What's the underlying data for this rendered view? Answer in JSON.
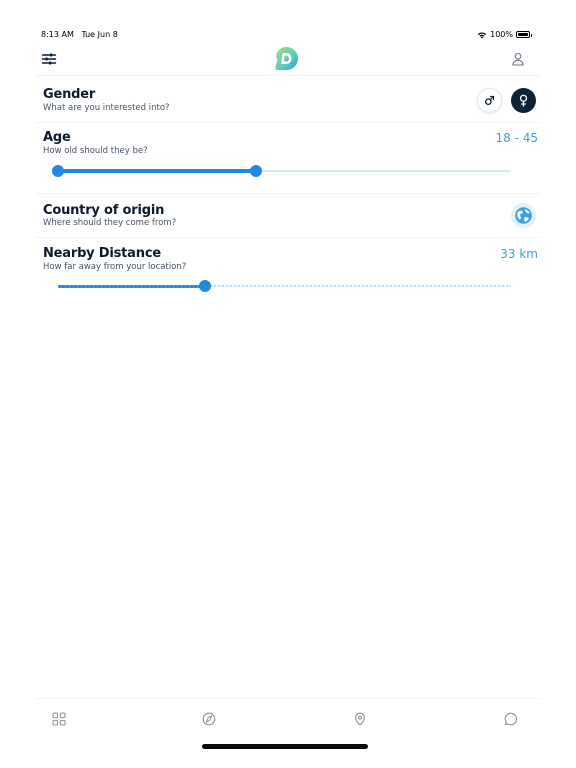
{
  "status_bar": {
    "time": "8:13 AM",
    "date": "Tue Jun 8",
    "battery": "100%"
  },
  "nav": {
    "filter_icon": "sliders-icon",
    "logo_icon": "d-logo-icon",
    "profile_icon": "user-icon"
  },
  "filters": {
    "gender": {
      "title": "Gender",
      "subtitle": "What are you interested into?",
      "options": [
        "male-symbol-icon",
        "female-symbol-icon"
      ],
      "selected": "female"
    },
    "age": {
      "title": "Age",
      "subtitle": "How old should they be?",
      "value": "18 - 45",
      "range_fraction": [
        0.0,
        0.437
      ]
    },
    "country": {
      "title": "Country of origin",
      "subtitle": "Where should they come from?",
      "icon": "globe-icon"
    },
    "distance": {
      "title": "Nearby Distance",
      "subtitle": "How far away from your location?",
      "value": "33 km",
      "fraction": 0.325
    }
  },
  "tab_bar": {
    "tabs": [
      "grid-icon",
      "compass-icon",
      "location-pin-icon",
      "chat-bubble-icon"
    ]
  },
  "colors": {
    "accent": "#2288e0",
    "value_text": "#38a3d9",
    "dark": "#0e2236",
    "track": "#d4ebf8"
  }
}
